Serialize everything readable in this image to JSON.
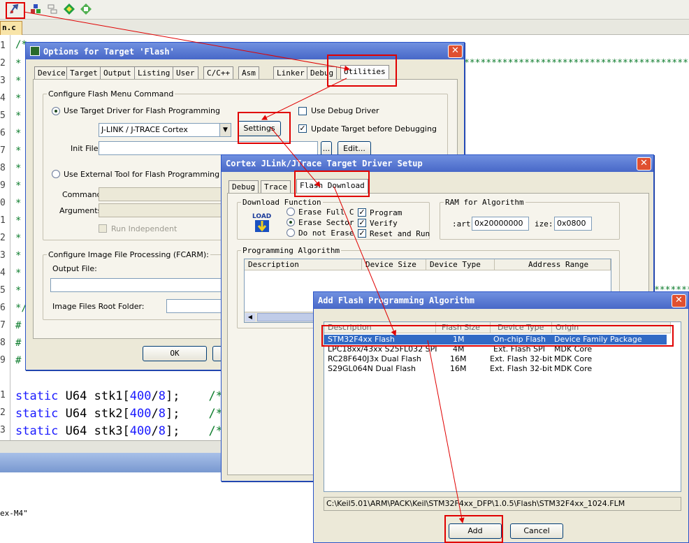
{
  "ide": {
    "file_tab": "n.c",
    "line_numbers": [
      "1",
      "2",
      "3",
      "4",
      "5",
      "6",
      "7",
      "8",
      "9",
      "0",
      "1",
      "2",
      "3",
      "4",
      "5",
      "6",
      "7",
      "8",
      "9",
      "",
      "1",
      "2",
      "3"
    ],
    "comment_first": "/*",
    "comment_close": "*/",
    "star_row": "****************************************************************************",
    "preproc_mark": "#",
    "code_lines": [
      {
        "kw": "static",
        "rest": " U64 stk1[",
        "num1": "400",
        "sep": "/",
        "num2": "8",
        "tail": "];",
        "comment": "/*"
      },
      {
        "kw": "static",
        "rest": " U64 stk2[",
        "num1": "400",
        "sep": "/",
        "num2": "8",
        "tail": "];",
        "comment": "/*"
      },
      {
        "kw": "static",
        "rest": " U64 stk3[",
        "num1": "400",
        "sep": "/",
        "num2": "8",
        "tail": "];",
        "comment": "/*"
      }
    ],
    "device_text": "ex-M4\""
  },
  "options_dialog": {
    "title": "Options for Target 'Flash'",
    "tabs": [
      "Device",
      "Target",
      "Output",
      "Listing",
      "User",
      "C/C++",
      "Asm",
      "Linker",
      "Debug",
      "Utilities"
    ],
    "configure_flash_group": "Configure Flash Menu Command",
    "use_target_driver": "Use Target Driver for Flash Programming",
    "driver_select": "J-LINK / J-TRACE Cortex",
    "settings_button": "Settings",
    "use_debug_driver": "Use Debug Driver",
    "update_target": "Update Target before Debugging",
    "init_file_label": "Init File:",
    "browse_button": "...",
    "edit_button": "Edit...",
    "use_external_tool": "Use External Tool for Flash Programming",
    "command_label": "Command:",
    "arguments_label": "Arguments:",
    "run_independent": "Run Independent",
    "image_group": "Configure Image File Processing (FCARM):",
    "output_file_label": "Output File:",
    "root_folder_label": "Image Files Root Folder:",
    "ok_button": "OK"
  },
  "driver_dialog": {
    "title": "Cortex JLink/JTrace Target Driver Setup",
    "tabs": [
      "Debug",
      "Trace",
      "Flash Download"
    ],
    "download_group": "Download Function",
    "load_icon_text": "LOAD",
    "erase_full": "Erase Full C",
    "erase_sectors": "Erase Sector",
    "do_not_erase": "Do not Erase",
    "program": "Program",
    "verify": "Verify",
    "reset_run": "Reset and Run",
    "ram_group": "RAM for Algorithm",
    "start_label": ":art:",
    "start_value": "0x20000000",
    "size_label": "ize:",
    "size_value": "0x0800",
    "prog_algo_group": "Programming Algorithm",
    "columns": [
      "Description",
      "Device Size",
      "Device Type",
      "Address Range"
    ]
  },
  "add_dialog": {
    "title": "Add Flash Programming Algorithm",
    "columns": [
      "Description",
      "Flash Size",
      "Device Type",
      "Origin"
    ],
    "rows": [
      {
        "desc": "STM32F4xx Flash",
        "size": "1M",
        "type": "On-chip Flash",
        "origin": "Device Family Package",
        "selected": true
      },
      {
        "desc": "LPC18xx/43xx S25FL032 SPI",
        "size": "4M",
        "type": "Ext. Flash SPI",
        "origin": "MDK Core",
        "selected": false
      },
      {
        "desc": "RC28F640J3x Dual Flash",
        "size": "16M",
        "type": "Ext. Flash 32-bit",
        "origin": "MDK Core",
        "selected": false
      },
      {
        "desc": "S29GL064N Dual Flash",
        "size": "16M",
        "type": "Ext. Flash 32-bit",
        "origin": "MDK Core",
        "selected": false
      }
    ],
    "path": "C:\\Keil5.01\\ARM\\PACK\\Keil\\STM32F4xx_DFP\\1.0.5\\Flash\\STM32F4xx_1024.FLM",
    "add_button": "Add",
    "cancel_button": "Cancel"
  },
  "colors": {
    "highlight": "#e00000",
    "titlebar": "#4868c8",
    "selection": "#316ac5",
    "comment": "#0c7c2c",
    "keyword": "#1a1aff"
  }
}
